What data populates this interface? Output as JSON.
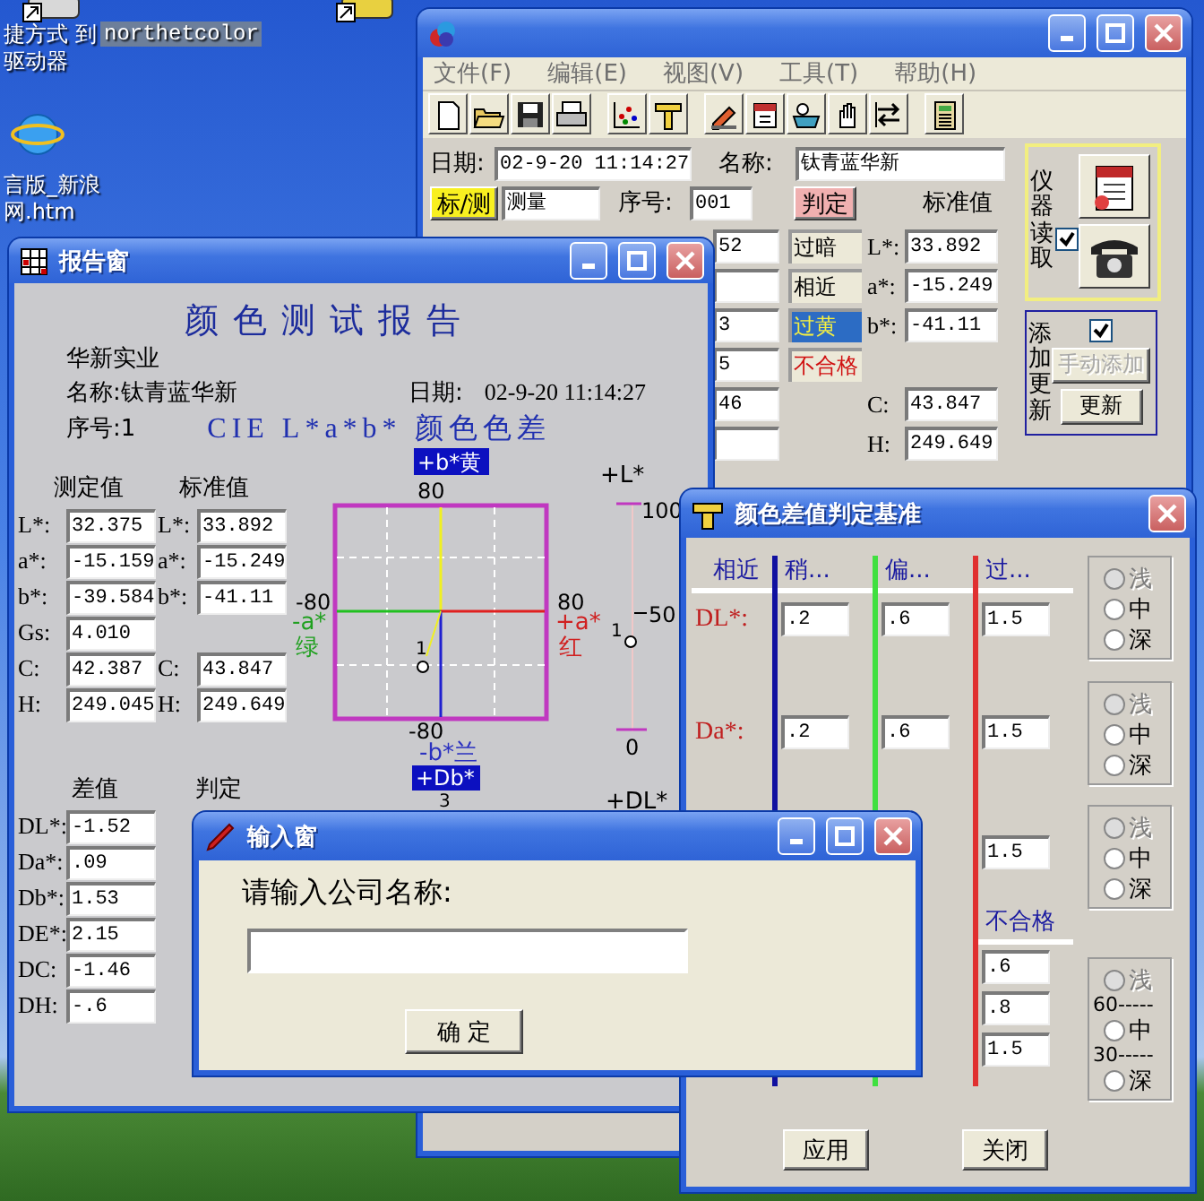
{
  "desktop": {
    "icons": [
      {
        "kind": "shortcut",
        "selected": false,
        "labels": [
          "捷方式 到",
          "驱动器"
        ]
      },
      {
        "kind": "shortcut",
        "selected": true,
        "labels": [
          "northetcolor"
        ]
      },
      {
        "kind": "browser",
        "selected": false,
        "labels": [
          "言版_新浪",
          "网.htm"
        ]
      }
    ]
  },
  "main_window": {
    "menu": [
      "文件(F)",
      "编辑(E)",
      "视图(V)",
      "工具(T)",
      "帮助(H)"
    ],
    "date_label": "日期:",
    "date": "02-9-20 11:14:27",
    "name_label": "名称:",
    "name": "钛青蓝华新",
    "mode_button": "标/测",
    "mode_value": "测量",
    "serial_label": "序号:",
    "serial": "001",
    "judge_button": "判定",
    "standard_heading": "标准值",
    "measured_fragments": [
      {
        "kind": "value",
        "value": "52"
      },
      {
        "kind": "blank"
      },
      {
        "kind": "value",
        "value": "3"
      },
      {
        "kind": "value",
        "value": "5"
      },
      {
        "kind": "value",
        "value": "46"
      },
      {
        "kind": "blank"
      }
    ],
    "judgements": [
      {
        "label": "过暗",
        "kind": "normal",
        "selected": false
      },
      {
        "label": "相近",
        "kind": "normal",
        "selected": false
      },
      {
        "label": "过黄",
        "kind": "normal",
        "selected": true
      },
      {
        "label": "不合格",
        "kind": "fail",
        "selected": false
      }
    ],
    "standard_lab": [
      {
        "label": "L*:",
        "value": "33.892"
      },
      {
        "label": "a*:",
        "value": "-15.249"
      },
      {
        "label": "b*:",
        "value": "-41.11"
      }
    ],
    "standard_ch": [
      {
        "label": "C:",
        "value": "43.847"
      },
      {
        "label": "H:",
        "value": "249.649"
      }
    ],
    "reader": {
      "label": "仪器读取",
      "checked": true
    },
    "update": {
      "label": "添加更新",
      "checked": true,
      "buttons": [
        {
          "label": "手动添加",
          "disabled": true
        },
        {
          "label": "更新",
          "disabled": false
        }
      ]
    }
  },
  "report_window": {
    "title": "报告窗",
    "heading": "颜色测试报告",
    "company": "华新实业",
    "name": "名称:钛青蓝华新",
    "date_label": "日期:",
    "date": "02-9-20 11:14:27",
    "serial": "序号:1",
    "subtitle": "CIE L*a*b* 颜色色差",
    "value_headers": [
      "测定值",
      "标准值"
    ],
    "values": [
      {
        "label": "L*:",
        "measured": "32.375",
        "std_label": "L*:",
        "standard": "33.892"
      },
      {
        "label": "a*:",
        "measured": "-15.159",
        "std_label": "a*:",
        "standard": "-15.249"
      },
      {
        "label": "b*:",
        "measured": "-39.584",
        "std_label": "b*:",
        "standard": "-41.11"
      },
      {
        "label": "Gs:",
        "measured": "4.010"
      },
      {
        "label": "C:",
        "measured": "42.387",
        "std_label": "C:",
        "standard": "43.847"
      },
      {
        "label": "H:",
        "measured": "249.045",
        "std_label": "H:",
        "standard": "249.649"
      }
    ],
    "ab_plot": {
      "top_label": "+b*黄",
      "top_tick": "80",
      "left_tick": "-80",
      "right_tick": "80",
      "left_label": [
        "-a*",
        "绿"
      ],
      "right_label": [
        "+a*",
        "红"
      ],
      "bottom_tick": "-80",
      "bottom_label": "-b*兰",
      "point_label": "1"
    },
    "lightness_scale": {
      "label": "+L*",
      "ticks": [
        "100",
        "50",
        "0"
      ],
      "point_label": "1"
    },
    "db_label": "+Db*",
    "db_tick": "3",
    "dl_label": "+DL*",
    "diff_headers": [
      "差值",
      "判定"
    ],
    "differences": [
      {
        "label": "DL*:",
        "value": "-1.52"
      },
      {
        "label": "Da*:",
        "value": ".09"
      },
      {
        "label": "Db*:",
        "value": "1.53"
      },
      {
        "label": "DE*:",
        "value": "2.15"
      },
      {
        "label": "DC:",
        "value": "-1.46"
      },
      {
        "label": "DH:",
        "value": "-.6"
      }
    ]
  },
  "criteria_window": {
    "title": "颜色差值判定基准",
    "column_headers": [
      "相近",
      "稍...",
      "偏...",
      "过..."
    ],
    "rows": [
      {
        "label": "DL*:",
        "values": [
          ".2",
          ".6",
          "1.5"
        ]
      },
      {
        "label": "Da*:",
        "values": [
          ".2",
          ".6",
          "1.5"
        ]
      },
      {
        "values": [
          "1.5"
        ]
      }
    ],
    "fail_heading": "不合格",
    "fail_values": [
      ".6",
      ".8",
      "1.5"
    ],
    "radio_groups": [
      {
        "options": [
          {
            "label": "浅",
            "selected": false,
            "disabled": true
          },
          {
            "label": "中",
            "selected": false,
            "disabled": false
          },
          {
            "label": "深",
            "selected": false,
            "disabled": false
          }
        ]
      },
      {
        "options": [
          {
            "label": "浅",
            "selected": false,
            "disabled": true
          },
          {
            "label": "中",
            "selected": false,
            "disabled": false
          },
          {
            "label": "深",
            "selected": false,
            "disabled": false
          }
        ]
      },
      {
        "options": [
          {
            "label": "浅",
            "selected": false,
            "disabled": true
          },
          {
            "label": "中",
            "selected": false,
            "disabled": false
          },
          {
            "label": "深",
            "selected": false,
            "disabled": false
          }
        ]
      },
      {
        "options": [
          {
            "label": "浅",
            "selected": false,
            "disabled": true
          },
          {
            "label": "中",
            "selected": false,
            "disabled": false
          },
          {
            "label": "深",
            "selected": false,
            "disabled": false
          }
        ],
        "marks": [
          "60-----",
          "30-----"
        ]
      }
    ],
    "buttons": [
      "应用",
      "关闭"
    ]
  },
  "input_dialog": {
    "title": "输入窗",
    "prompt": "请输入公司名称:",
    "ok_button": "确 定"
  }
}
